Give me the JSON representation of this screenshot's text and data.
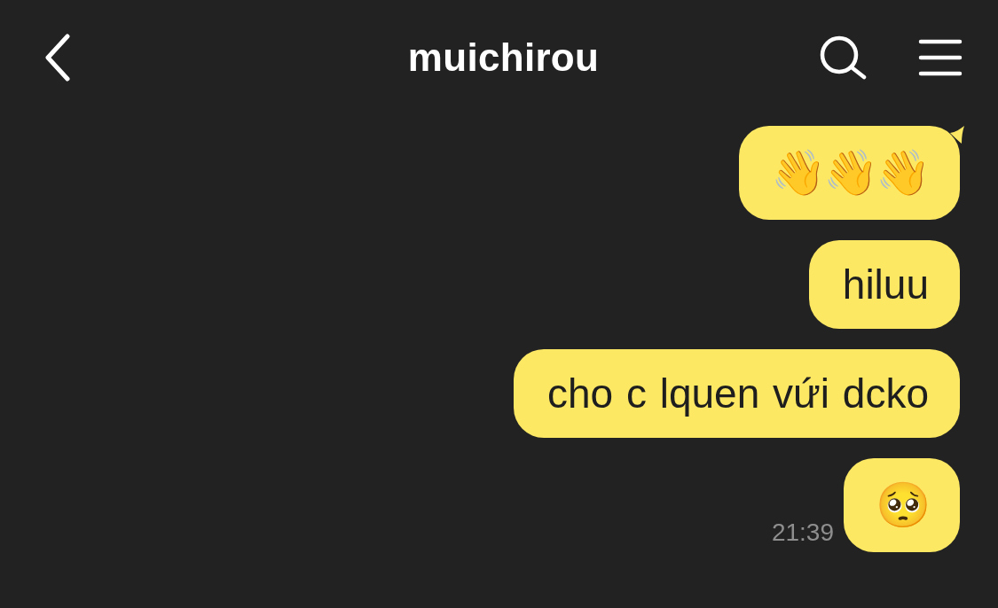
{
  "header": {
    "title": "muichirou"
  },
  "messages": [
    {
      "kind": "emoji",
      "text": "👋👋👋",
      "tail": true
    },
    {
      "kind": "text",
      "text": "hiluu",
      "tail": false
    },
    {
      "kind": "text",
      "text": "cho c lquen vứi dcko",
      "tail": false
    },
    {
      "kind": "emoji",
      "text": "🥺",
      "tail": false,
      "time": "21:39"
    }
  ]
}
